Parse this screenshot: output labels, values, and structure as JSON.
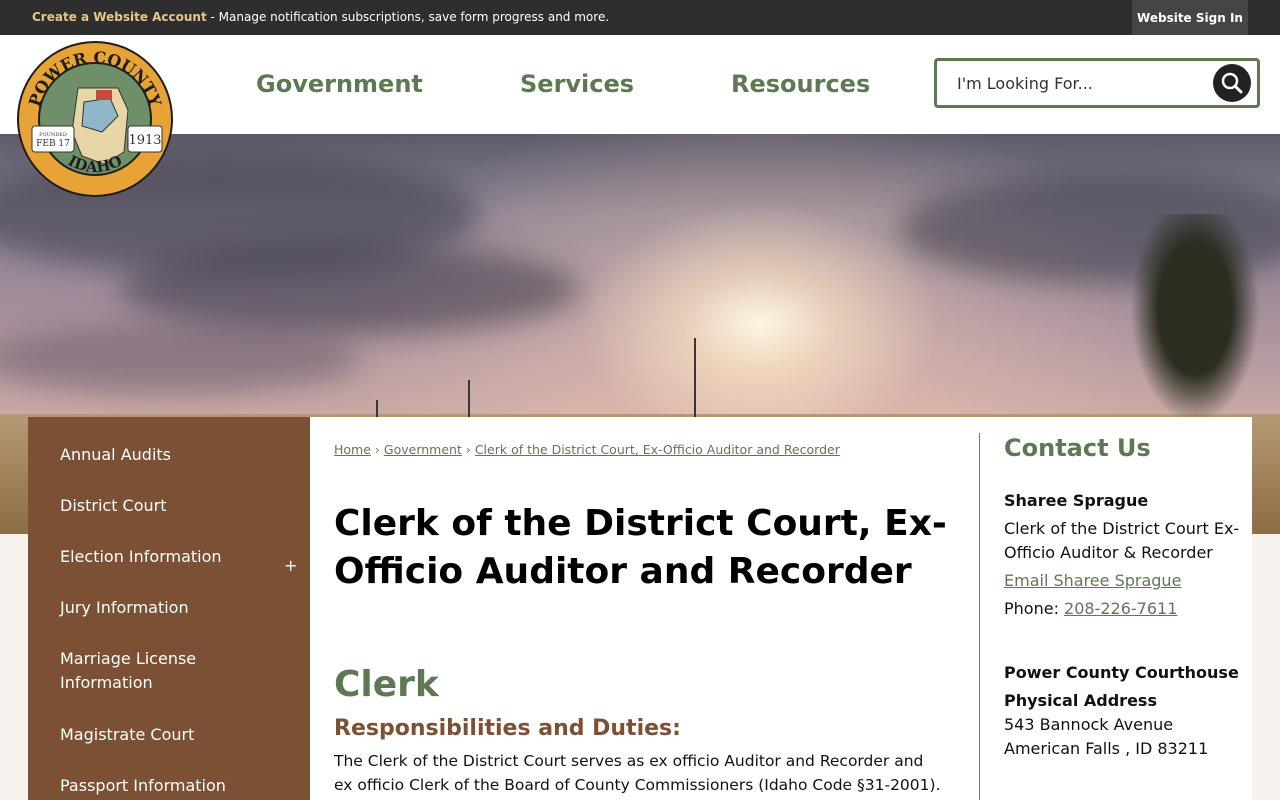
{
  "topbar": {
    "create_link": "Create a Website Account",
    "create_desc": " - Manage notification subscriptions, save form progress and more.",
    "sign_in": "Website Sign In"
  },
  "logo": {
    "top_text": "POWER COUNTY",
    "bottom_text": "IDAHO",
    "founded": "FOUNDED",
    "date": "FEB 17",
    "year": "1913"
  },
  "nav": [
    "Government",
    "Services",
    "Resources"
  ],
  "search": {
    "placeholder": "I'm Looking For..."
  },
  "sidebar": {
    "items": [
      "Annual Audits",
      "District Court",
      "Election Information",
      "Jury Information",
      "Marriage License Information",
      "Magistrate Court",
      "Passport Information"
    ],
    "expand_symbol": "+"
  },
  "breadcrumb": {
    "items": [
      "Home",
      "Government",
      "Clerk of the District Court, Ex-Officio Auditor and Recorder"
    ],
    "separator": "›"
  },
  "page": {
    "title": "Clerk of the District Court, Ex-Officio Auditor and Recorder",
    "section_title": "Clerk",
    "subsection_title": "Responsibilities and Duties:",
    "paragraph": "The Clerk of the District Court serves as ex officio Auditor and Recorder and ex officio Clerk of the Board of County Commissioners (Idaho Code §31-2001)."
  },
  "contact": {
    "title": "Contact Us",
    "name": "Sharee Sprague",
    "role_line1": "Clerk of the District Court Ex-",
    "role_line2": "Officio Auditor & Recorder",
    "email_link": "Email Sharee Sprague",
    "phone_label": "Phone: ",
    "phone": "208-226-7611",
    "building": "Power County Courthouse",
    "address_label": "Physical Address",
    "street": "543 Bannock Avenue",
    "city": "American Falls , ID 83211"
  },
  "colors": {
    "accent_green": "#5f7854",
    "sidebar_brown": "#7b5034",
    "topbar": "#2e2e2e",
    "link_gold": "#e8c783"
  }
}
